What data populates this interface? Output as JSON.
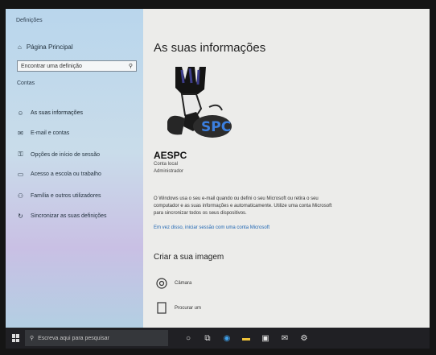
{
  "sidebar": {
    "app_title": "Definições",
    "home_label": "Página Principal",
    "search_placeholder": "Encontrar uma definição",
    "section_label": "Contas",
    "items": [
      {
        "label": "As suas informações",
        "icon": "person-icon"
      },
      {
        "label": "E-mail e contas",
        "icon": "mail-icon"
      },
      {
        "label": "Opções de início de sessão",
        "icon": "key-icon"
      },
      {
        "label": "Acesso a escola ou trabalho",
        "icon": "briefcase-icon"
      },
      {
        "label": "Família e outros utilizadores",
        "icon": "people-icon"
      },
      {
        "label": "Sincronizar as suas definições",
        "icon": "sync-icon"
      }
    ]
  },
  "main": {
    "title": "As suas informações",
    "user_name": "AESPC",
    "account_type": "Conta local",
    "account_role": "Administrador",
    "info_text": "O Windows usa o seu e-mail quando ou defini o seu Microsoft ou retira o seu computador e as suas informações e automaticamente. Utilize uma conta Microsoft para sincronizar todos os seus dispositivos.",
    "link_text": "Em vez disso, iniciar sessão com uma conta Microsoft",
    "create_heading": "Criar a sua imagem",
    "options": [
      {
        "label": "Câmara",
        "icon": "camera-icon"
      },
      {
        "label": "Procurar um",
        "icon": "browse-icon"
      }
    ]
  },
  "taskbar": {
    "search_placeholder": "Escreva aqui para pesquisar"
  }
}
